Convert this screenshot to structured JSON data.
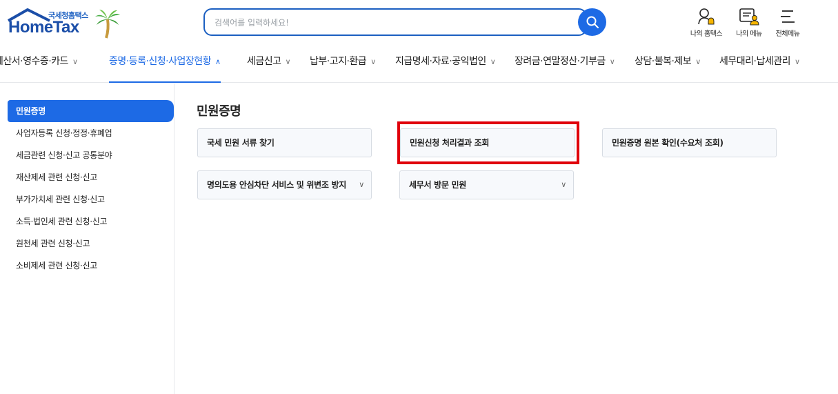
{
  "header": {
    "logo_small": "국세청홈택스",
    "logo_main": "HomeTax",
    "search_placeholder": "검색어를 입력하세요!",
    "utils": [
      {
        "label": "나의 홈택스",
        "icon": "user-bell-icon"
      },
      {
        "label": "나의 메뉴",
        "icon": "my-menu-icon"
      },
      {
        "label": "전체메뉴",
        "icon": "hamburger-icon"
      }
    ]
  },
  "nav": {
    "items": [
      {
        "label": "계산서·영수증·카드"
      },
      {
        "label": "증명·등록·신청·사업장현황",
        "active": true
      },
      {
        "label": "세금신고"
      },
      {
        "label": "납부·고지·환급"
      },
      {
        "label": "지급명세·자료·공익법인"
      },
      {
        "label": "장려금·연말정산·기부금"
      },
      {
        "label": "상담·불복·제보"
      },
      {
        "label": "세무대리·납세관리"
      }
    ]
  },
  "sidebar": {
    "items": [
      {
        "label": "민원증명",
        "active": true
      },
      {
        "label": "사업자등록 신청·정정·휴폐업"
      },
      {
        "label": "세금관련 신청·신고 공통분야"
      },
      {
        "label": "재산제세 관련 신청·신고"
      },
      {
        "label": "부가가치세 관련 신청·신고"
      },
      {
        "label": "소득·법인세 관련 신청·신고"
      },
      {
        "label": "원천세 관련 신청·신고"
      },
      {
        "label": "소비제세 관련 신청·신고"
      }
    ]
  },
  "main": {
    "title": "민원증명",
    "cards": [
      {
        "label": "국세 민원 서류 찾기",
        "has_dropdown": false
      },
      {
        "label": "민원신청 처리결과 조회",
        "has_dropdown": false,
        "highlighted": true
      },
      {
        "label": "민원증명 원본 확인(수요처 조회)",
        "has_dropdown": false
      },
      {
        "label": "명의도용 안심차단 서비스 및 위변조 방지",
        "has_dropdown": true
      },
      {
        "label": "세무서 방문 민원",
        "has_dropdown": true
      }
    ]
  },
  "colors": {
    "accent": "#1d6ae5",
    "highlight": "#e0000b",
    "card_bg": "#f7f9fc"
  }
}
